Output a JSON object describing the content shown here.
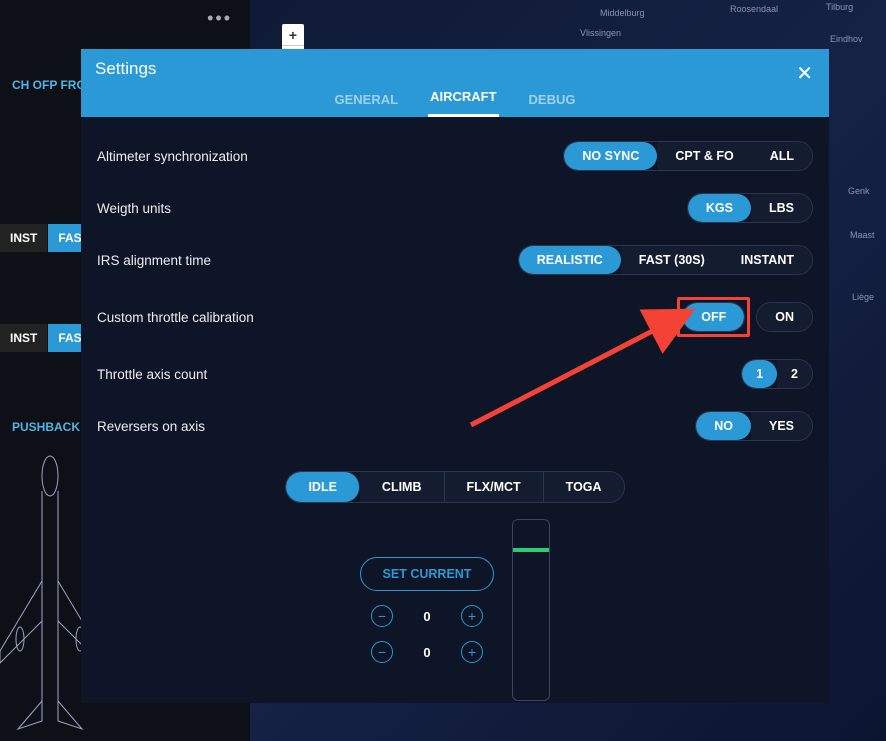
{
  "map": {
    "labels": [
      "Middelburg",
      "Vlissingen",
      "Roosendaal",
      "Tilburg",
      "Eindhov",
      "Genk",
      "Maast",
      "Liège"
    ]
  },
  "sidebar": {
    "ofp_label": "CH OFP FROM",
    "row1": [
      "INST",
      "FAST"
    ],
    "row2": [
      "INST",
      "FAST"
    ],
    "pushback": "PUSHBACK"
  },
  "zoom": {
    "plus": "+",
    "reset": "▯"
  },
  "modal": {
    "title": "Settings",
    "tabs": [
      {
        "label": "GENERAL",
        "active": false
      },
      {
        "label": "AIRCRAFT",
        "active": true
      },
      {
        "label": "DEBUG",
        "active": false
      }
    ],
    "rows": {
      "altimeter": {
        "label": "Altimeter synchronization",
        "opts": [
          "NO SYNC",
          "CPT & FO",
          "ALL"
        ],
        "selected": 0
      },
      "weight": {
        "label": "Weigth units",
        "opts": [
          "KGS",
          "LBS"
        ],
        "selected": 0
      },
      "irs": {
        "label": "IRS alignment time",
        "opts": [
          "REALISTIC",
          "FAST (30S)",
          "INSTANT"
        ],
        "selected": 0
      },
      "throttle_cal": {
        "label": "Custom throttle calibration",
        "opts": [
          "OFF",
          "ON"
        ],
        "selected": 0
      },
      "axis_count": {
        "label": "Throttle axis count",
        "opts": [
          "1",
          "2"
        ],
        "selected": 0
      },
      "reversers": {
        "label": "Reversers on axis",
        "opts": [
          "NO",
          "YES"
        ],
        "selected": 0
      }
    },
    "detents": {
      "opts": [
        "IDLE",
        "CLIMB",
        "FLX/MCT",
        "TOGA"
      ],
      "selected": 0
    },
    "set_current": "SET CURRENT",
    "steppers": [
      0,
      0
    ]
  }
}
